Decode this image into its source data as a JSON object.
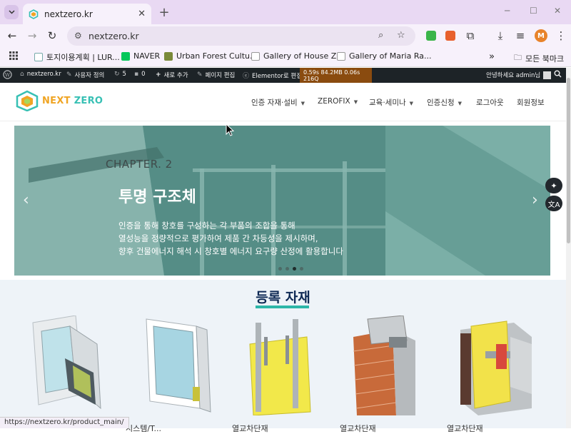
{
  "browser": {
    "tab_title": "nextzero.kr",
    "url": "nextzero.kr",
    "profile_initial": "M",
    "bookmarks": [
      {
        "label": "토지이용계획 | LUR..."
      },
      {
        "label": "NAVER"
      },
      {
        "label": "Urban Forest Cultu..."
      },
      {
        "label": "Gallery of House Z..."
      },
      {
        "label": "Gallery of Maria Ra..."
      }
    ],
    "bookmarks_overflow": "»",
    "all_bookmarks": "모든 북마크"
  },
  "adminbar": {
    "site": "nextzero.kr",
    "customize": "사용자 정의",
    "updates": "5",
    "comments": "0",
    "new": "새로 추가",
    "edit_page": "페이지 편집",
    "elementor": "Elementor로 편집",
    "perf": "0.59s  84.2MB  0.06s  216Q",
    "greeting": "안녕하세요 admin님"
  },
  "site": {
    "logo_next": "NEXT ",
    "logo_zero": "ZERO",
    "menu": [
      {
        "label": "인증 자재·설비",
        "has_caret": true
      },
      {
        "label": "ZEROFIX",
        "has_caret": true
      },
      {
        "label": "교육·세미나",
        "has_caret": true
      },
      {
        "label": "인증신청",
        "has_caret": true
      },
      {
        "label": "로그아웃",
        "has_caret": false
      },
      {
        "label": "회원정보",
        "has_caret": false
      }
    ]
  },
  "hero": {
    "chapter": "CHAPTER. 2",
    "title": "투명 구조체",
    "desc_lines": [
      "인증을 통해  창호를 구성하는 각 부품의 조합을 통해",
      "열성능을 정량적으로 평가하여 제품 간 차등성을 제시하며,",
      "향후 건물에너지 해석 시 창호별 에너지 요구량 산정에 활용합니다"
    ],
    "slide_count": 4,
    "active_slide": 2
  },
  "materials": {
    "title": "등록 자재",
    "items": [
      {
        "label": ""
      },
      {
        "label": "시스템/T..."
      },
      {
        "label": "열교차단재"
      },
      {
        "label": "열교차단재"
      },
      {
        "label": "열교차단재"
      }
    ]
  },
  "status_bar": "https://nextzero.kr/product_main/",
  "colors": {
    "accent_teal": "#2db6a8",
    "title_navy": "#0f2a55",
    "logo_orange": "#f0a524",
    "admin_bar": "#1d2327"
  }
}
